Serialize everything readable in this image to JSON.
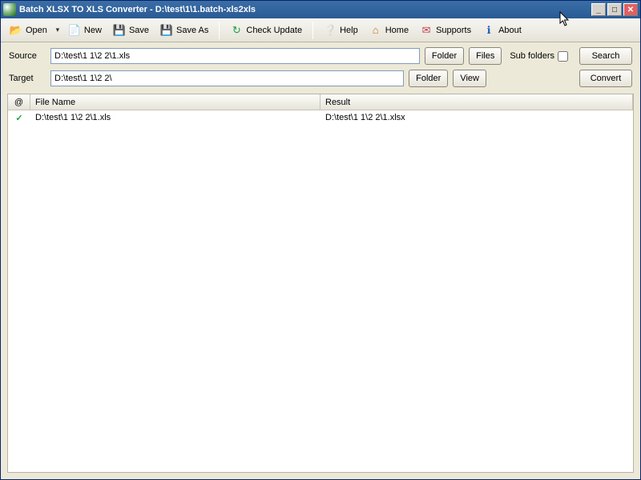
{
  "window": {
    "title": "Batch XLSX TO XLS Converter - D:\\test\\1\\1.batch-xls2xls"
  },
  "toolbar": {
    "open": "Open",
    "new": "New",
    "save": "Save",
    "save_as": "Save As",
    "check_update": "Check Update",
    "help": "Help",
    "home": "Home",
    "supports": "Supports",
    "about": "About"
  },
  "paths": {
    "source_label": "Source",
    "source_value": "D:\\test\\1 1\\2 2\\1.xls",
    "target_label": "Target",
    "target_value": "D:\\test\\1 1\\2 2\\",
    "folder_btn": "Folder",
    "files_btn": "Files",
    "view_btn": "View",
    "sub_folders_label": "Sub folders",
    "sub_folders_checked": false,
    "search_btn": "Search",
    "convert_btn": "Convert"
  },
  "list": {
    "col_at": "@",
    "col_file": "File Name",
    "col_result": "Result",
    "rows": [
      {
        "status": "ok",
        "file": "D:\\test\\1 1\\2 2\\1.xls",
        "result": "D:\\test\\1 1\\2 2\\1.xlsx"
      }
    ]
  },
  "icons": {
    "open": "📂",
    "new": "📄",
    "save": "💾",
    "saveas": "💾",
    "check": "↻",
    "help": "❔",
    "home": "⌂",
    "support": "✉",
    "about": "ℹ",
    "check_row": "✓"
  }
}
